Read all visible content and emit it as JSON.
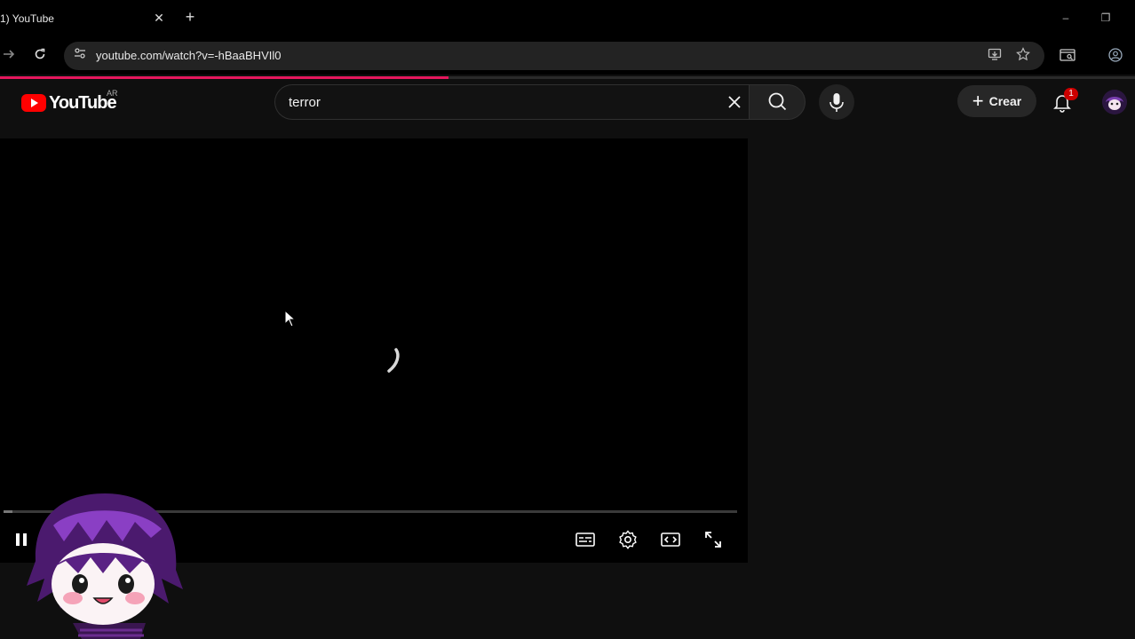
{
  "browser": {
    "tab_title": "1) YouTube",
    "tab_close": "✕",
    "new_tab": "+",
    "url": "youtube.com/watch?v=-hBaaBHVIl0",
    "window_controls": {
      "minimize": "–",
      "restore": "❐"
    }
  },
  "page": {
    "load_progress": 0.395,
    "accent_color": "#e4175d"
  },
  "header": {
    "logo_text": "YouTube",
    "logo_region": "AR",
    "search_value": "terror",
    "create_label": "Crear",
    "notification_count": "1"
  },
  "player": {
    "state": "loading",
    "scrub_progress": 0.012,
    "controls": [
      "pause-icon",
      "subtitles-icon",
      "settings-icon",
      "theater-icon",
      "fullscreen-icon"
    ]
  },
  "icons": {
    "forward": "forward-icon",
    "reload": "reload-icon",
    "site_info": "tune-icon",
    "cast": "install-icon",
    "bookmark": "star-icon",
    "tab_search": "tab-search-icon",
    "profile": "profile-icon",
    "search": "search-icon",
    "mic": "mic-icon",
    "bell": "bell-icon"
  }
}
